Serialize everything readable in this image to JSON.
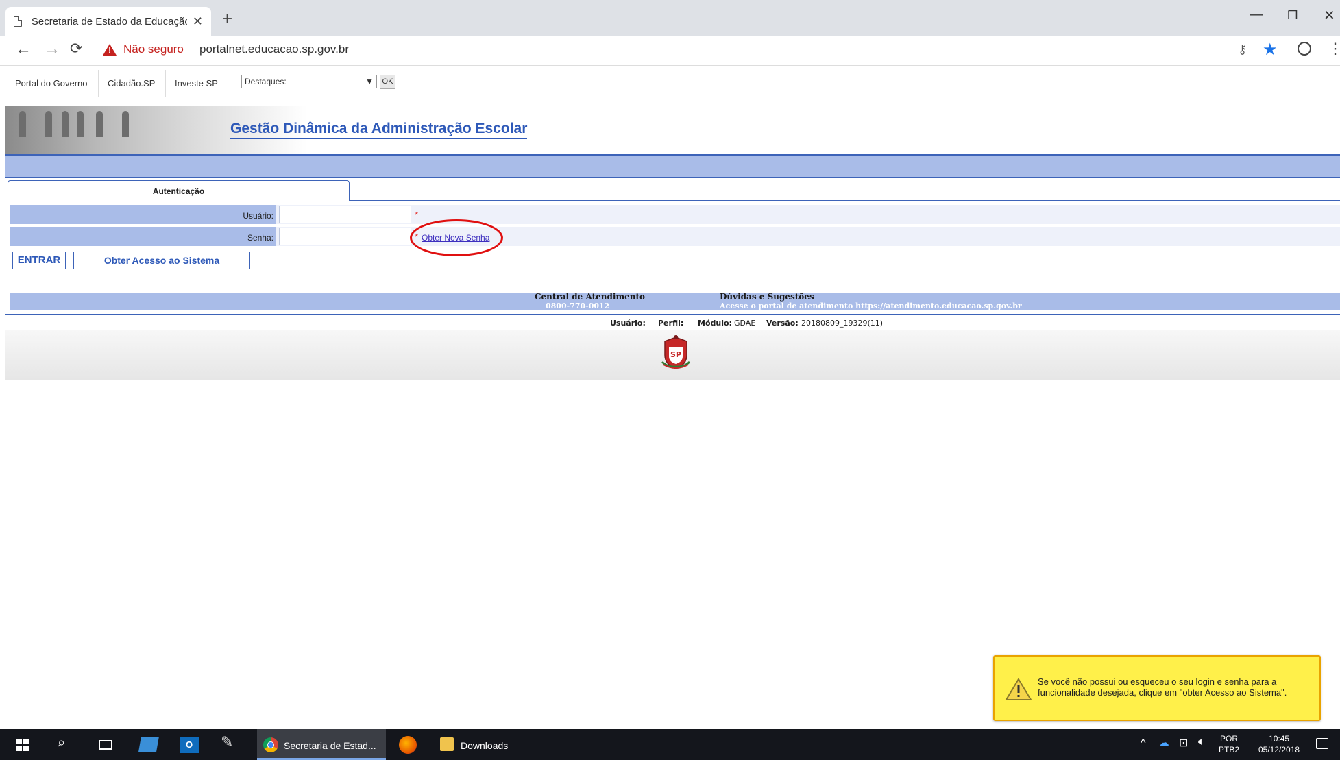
{
  "browser": {
    "tab_title": "Secretaria de Estado da Educação",
    "new_tab": "+",
    "security_text": "Não seguro",
    "url": "portalnet.educacao.sp.gov.br"
  },
  "govbar": {
    "links": [
      "Portal do Governo",
      "Cidadão.SP",
      "Investe SP"
    ],
    "destaques": "Destaques:",
    "ok_label": "OK"
  },
  "header": {
    "title": "Gestão Dinâmica da Administração Escolar"
  },
  "auth": {
    "tab_label": "Autenticação",
    "usuario_label": "Usuário:",
    "senha_label": "Senha:",
    "required_mark": "*",
    "nova_senha_link": "Obter Nova Senha",
    "entrar_button": "ENTRAR",
    "acesso_button": "Obter Acesso ao Sistema"
  },
  "footer": {
    "central_title": "Central de Atendimento",
    "central_phone": "0800-770-0012",
    "duvidas_title": "Dúvidas e Sugestões",
    "duvidas_text": "Acesse o portal de atendimento https://atendimento.educacao.sp.gov.br",
    "usuario_label": "Usuário:",
    "perfil_label": "Perfil:",
    "modulo_label": "Módulo:",
    "modulo_value": "GDAE",
    "versao_label": "Versão:",
    "versao_value": "20180809_19329(11)"
  },
  "notification": {
    "text": "Se você não possui ou esqueceu o seu login e senha para a funcionalidade desejada, clique em \"obter Acesso ao Sistema\"."
  },
  "taskbar": {
    "chrome_label": "Secretaria de Estad...",
    "downloads_label": "Downloads",
    "lang_top": "POR",
    "lang_bottom": "PTB2",
    "time": "10:45",
    "date": "05/12/2018"
  },
  "colors": {
    "accent_blue": "#3d63b8",
    "band_blue": "#a9bce8",
    "notify_yellow": "#fff04a",
    "taskbar": "#14161c"
  }
}
